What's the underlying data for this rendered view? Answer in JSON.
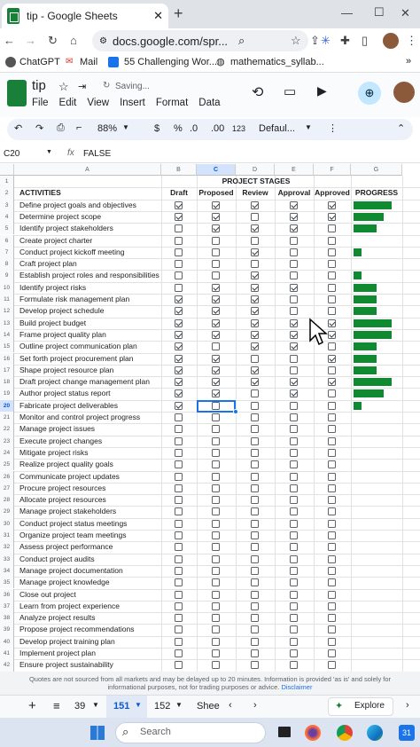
{
  "browser": {
    "tab_title": "tip - Google Sheets",
    "url": "docs.google.com/spr...",
    "bookmarks": [
      "ChatGPT",
      "Mail",
      "55 Challenging Wor...",
      "mathematics_syllab..."
    ]
  },
  "doc": {
    "title": "tip",
    "status": "Saving...",
    "menu": [
      "File",
      "Edit",
      "View",
      "Insert",
      "Format",
      "Data"
    ]
  },
  "toolbar": {
    "zoom": "88%",
    "currency": "$",
    "percent": "%",
    "dec_decrease": ".0",
    "dec_increase": ".00",
    "number_format": "123",
    "font": "Defaul..."
  },
  "formula": {
    "cell_ref": "C20",
    "value": "FALSE"
  },
  "sheet": {
    "columns": [
      "A",
      "B",
      "C",
      "D",
      "E",
      "F",
      "G"
    ],
    "stages_header": "PROJECT STAGES",
    "activities_header": "ACTIVITIES",
    "stage_names": [
      "Draft",
      "Proposed",
      "Review",
      "Approval",
      "Approved"
    ],
    "progress_header": "PROGRESS",
    "row_numbers": [
      "1",
      "2",
      "3",
      "4",
      "5",
      "6",
      "7",
      "8",
      "9",
      "10",
      "11",
      "12",
      "13",
      "14",
      "15",
      "16",
      "17",
      "18",
      "19",
      "20",
      "21",
      "22",
      "23",
      "24",
      "25",
      "26",
      "27",
      "28",
      "29",
      "30",
      "31",
      "32",
      "33",
      "34",
      "35",
      "36",
      "37",
      "38",
      "39",
      "40",
      "41",
      "42"
    ],
    "rows": [
      {
        "activity": "Define project goals and objectives",
        "checks": [
          1,
          1,
          1,
          1,
          1
        ],
        "progress": 1.0
      },
      {
        "activity": "Determine project scope",
        "checks": [
          1,
          1,
          0,
          1,
          1
        ],
        "progress": 0.8
      },
      {
        "activity": "Identify project stakeholders",
        "checks": [
          0,
          1,
          1,
          1,
          0
        ],
        "progress": 0.6
      },
      {
        "activity": "Create project charter",
        "checks": [
          0,
          0,
          0,
          0,
          0
        ],
        "progress": 0.0
      },
      {
        "activity": "Conduct project kickoff meeting",
        "checks": [
          0,
          0,
          1,
          0,
          0
        ],
        "progress": 0.2
      },
      {
        "activity": "Craft project plan",
        "checks": [
          0,
          0,
          0,
          0,
          0
        ],
        "progress": 0.0
      },
      {
        "activity": "Establish project roles and responsibilities",
        "checks": [
          0,
          0,
          1,
          0,
          0
        ],
        "progress": 0.2
      },
      {
        "activity": "Identify project risks",
        "checks": [
          0,
          1,
          1,
          1,
          0
        ],
        "progress": 0.6
      },
      {
        "activity": "Formulate risk management plan",
        "checks": [
          1,
          1,
          1,
          0,
          0
        ],
        "progress": 0.6
      },
      {
        "activity": "Develop project schedule",
        "checks": [
          1,
          1,
          1,
          0,
          0
        ],
        "progress": 0.6
      },
      {
        "activity": "Build project budget",
        "checks": [
          1,
          1,
          1,
          1,
          1
        ],
        "progress": 1.0
      },
      {
        "activity": "Frame project quality plan",
        "checks": [
          1,
          1,
          1,
          1,
          1
        ],
        "progress": 1.0
      },
      {
        "activity": "Outline project communication plan",
        "checks": [
          1,
          0,
          1,
          1,
          0
        ],
        "progress": 0.6
      },
      {
        "activity": "Set forth project procurement plan",
        "checks": [
          1,
          1,
          0,
          0,
          1
        ],
        "progress": 0.6
      },
      {
        "activity": "Shape project resource plan",
        "checks": [
          1,
          1,
          1,
          0,
          0
        ],
        "progress": 0.6
      },
      {
        "activity": "Draft project change management plan",
        "checks": [
          1,
          1,
          1,
          1,
          1
        ],
        "progress": 1.0
      },
      {
        "activity": "Author project status report",
        "checks": [
          1,
          1,
          0,
          1,
          0
        ],
        "progress": 0.8
      },
      {
        "activity": "Fabricate project deliverables",
        "checks": [
          1,
          0,
          0,
          0,
          0
        ],
        "progress": 0.2
      },
      {
        "activity": "Monitor and control project progress",
        "checks": [
          0,
          0,
          0,
          0,
          0
        ],
        "progress": 0.0
      },
      {
        "activity": "Manage project issues",
        "checks": [
          0,
          0,
          0,
          0,
          0
        ],
        "progress": 0.0
      },
      {
        "activity": "Execute project changes",
        "checks": [
          0,
          0,
          0,
          0,
          0
        ],
        "progress": 0.0
      },
      {
        "activity": "Mitigate project risks",
        "checks": [
          0,
          0,
          0,
          0,
          0
        ],
        "progress": 0.0
      },
      {
        "activity": "Realize project quality goals",
        "checks": [
          0,
          0,
          0,
          0,
          0
        ],
        "progress": 0.0
      },
      {
        "activity": "Communicate project updates",
        "checks": [
          0,
          0,
          0,
          0,
          0
        ],
        "progress": 0.0
      },
      {
        "activity": "Procure project resources",
        "checks": [
          0,
          0,
          0,
          0,
          0
        ],
        "progress": 0.0
      },
      {
        "activity": "Allocate project resources",
        "checks": [
          0,
          0,
          0,
          0,
          0
        ],
        "progress": 0.0
      },
      {
        "activity": "Manage project stakeholders",
        "checks": [
          0,
          0,
          0,
          0,
          0
        ],
        "progress": 0.0
      },
      {
        "activity": "Conduct project status meetings",
        "checks": [
          0,
          0,
          0,
          0,
          0
        ],
        "progress": 0.0
      },
      {
        "activity": "Organize project team meetings",
        "checks": [
          0,
          0,
          0,
          0,
          0
        ],
        "progress": 0.0
      },
      {
        "activity": "Assess project performance",
        "checks": [
          0,
          0,
          0,
          0,
          0
        ],
        "progress": 0.0
      },
      {
        "activity": "Conduct project audits",
        "checks": [
          0,
          0,
          0,
          0,
          0
        ],
        "progress": 0.0
      },
      {
        "activity": "Manage project documentation",
        "checks": [
          0,
          0,
          0,
          0,
          0
        ],
        "progress": 0.0
      },
      {
        "activity": "Manage project knowledge",
        "checks": [
          0,
          0,
          0,
          0,
          0
        ],
        "progress": 0.0
      },
      {
        "activity": "Close out project",
        "checks": [
          0,
          0,
          0,
          0,
          0
        ],
        "progress": 0.0
      },
      {
        "activity": "Learn from project experience",
        "checks": [
          0,
          0,
          0,
          0,
          0
        ],
        "progress": 0.0
      },
      {
        "activity": "Analyze project results",
        "checks": [
          0,
          0,
          0,
          0,
          0
        ],
        "progress": 0.0
      },
      {
        "activity": "Propose project recommendations",
        "checks": [
          0,
          0,
          0,
          0,
          0
        ],
        "progress": 0.0
      },
      {
        "activity": "Develop project training plan",
        "checks": [
          0,
          0,
          0,
          0,
          0
        ],
        "progress": 0.0
      },
      {
        "activity": "Implement project plan",
        "checks": [
          0,
          0,
          0,
          0,
          0
        ],
        "progress": 0.0
      },
      {
        "activity": "Ensure project sustainability",
        "checks": [
          0,
          0,
          0,
          0,
          0
        ],
        "progress": 0.0
      }
    ],
    "progress_color": "#0f8a30"
  },
  "disclaimer": {
    "text": "Quotes are not sourced from all markets and may be delayed up to 20 minutes. Information is provided 'as is' and solely for informational purposes, not for trading purposes or advice.",
    "link": "Disclaimer"
  },
  "sheet_tabs": {
    "tabs": [
      "39",
      "151",
      "152",
      "Shee"
    ],
    "active": "151",
    "explore": "Explore"
  },
  "taskbar": {
    "search": "Search",
    "calendar_day": "31"
  }
}
